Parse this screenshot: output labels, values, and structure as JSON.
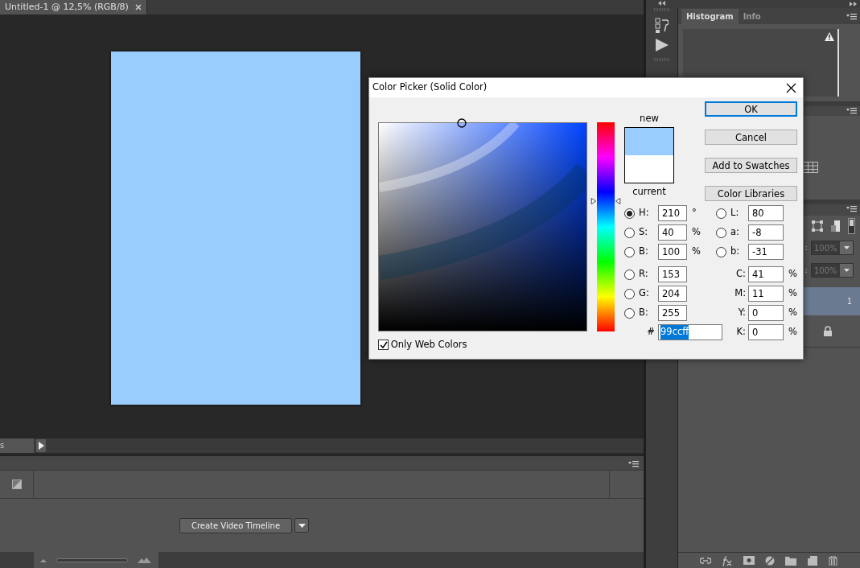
{
  "document_tab": {
    "title": "Untitled-1 @ 12,5% (RGB/8)",
    "selected": true
  },
  "status_bar": {
    "text": "s"
  },
  "timeline": {
    "button": "Create Video Timeline",
    "zoom_slider": {
      "level": 1
    }
  },
  "right_panel": {
    "tabs": [
      {
        "label": "Histogram",
        "selected": true
      },
      {
        "label": "Info",
        "selected": false
      }
    ],
    "layers": {
      "rows": [
        {
          "label": ":",
          "value": "100%"
        },
        {
          "label": ":",
          "value": "100%"
        }
      ],
      "layer_text": "1"
    }
  },
  "dialog": {
    "title": "Color Picker (Solid Color)",
    "hue_slider": {
      "level": 0.625
    },
    "only_web_colors": {
      "label": "Only Web Colors",
      "checked": true
    },
    "swatches": [
      {
        "label": "new",
        "color": "#99ccff"
      },
      {
        "label": "current",
        "color": "#ffffff"
      }
    ],
    "buttons": [
      {
        "label": "OK",
        "default": true
      },
      {
        "label": "Cancel",
        "default": false
      },
      {
        "label": "Add to Swatches",
        "default": false
      },
      {
        "label": "Color Libraries",
        "default": false
      }
    ],
    "left_fields": [
      {
        "kind": "radio",
        "label": "H:",
        "value": "210",
        "unit": "°",
        "selected": true
      },
      {
        "kind": "radio",
        "label": "S:",
        "value": "40",
        "unit": "%",
        "selected": false
      },
      {
        "kind": "radio",
        "label": "B:",
        "value": "100",
        "unit": "%",
        "selected": false
      },
      {
        "kind": "radio",
        "label": "R:",
        "value": "153",
        "selected": false
      },
      {
        "kind": "radio",
        "label": "G:",
        "value": "204",
        "selected": false
      },
      {
        "kind": "radio",
        "label": "B:",
        "value": "255",
        "selected": false
      }
    ],
    "right_fields": [
      {
        "kind": "radio",
        "label": "L:",
        "value": "80",
        "selected": false
      },
      {
        "kind": "radio",
        "label": "a:",
        "value": "-8",
        "selected": false
      },
      {
        "kind": "radio",
        "label": "b:",
        "value": "-31",
        "selected": false
      },
      {
        "kind": "plain",
        "label": "C:",
        "value": "41",
        "unit": "%"
      },
      {
        "kind": "plain",
        "label": "M:",
        "value": "11",
        "unit": "%"
      },
      {
        "kind": "plain",
        "label": "Y:",
        "value": "0",
        "unit": "%"
      },
      {
        "kind": "plain",
        "label": "K:",
        "value": "0",
        "unit": "%"
      }
    ],
    "hex": {
      "label": "#",
      "value": "99ccff"
    }
  }
}
